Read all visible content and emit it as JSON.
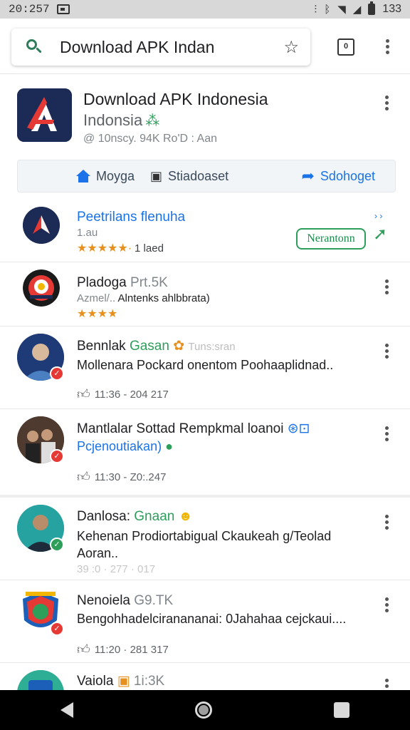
{
  "status_bar": {
    "time": "20:257",
    "battery": "133",
    "icons": [
      "image-icon",
      "vibrate-icon",
      "bluetooth-icon",
      "wifi-icon",
      "signal-icon",
      "battery-icon"
    ]
  },
  "search": {
    "value": "Download APK Indan",
    "tabs_count": "0"
  },
  "header": {
    "title": "Download APK Indonesia",
    "subtitle": "Indonsia",
    "meta": "@ 10nscy. 94K Ro'D : Aan",
    "actions": {
      "home": "Moyga",
      "chat": "Stiadoaset",
      "share": "Sdohoget"
    }
  },
  "items": [
    {
      "title": "Peetrilans flenuha",
      "line1": "1.au",
      "rating_text": "1 laed",
      "open_label": "Nerantonn",
      "arrows": "› ›"
    },
    {
      "title": "Pladoga",
      "title_extra": "Prt.5K",
      "line1_a": "Azmel/..",
      "line1_b": "Alntenks ahlbbrata)"
    },
    {
      "title": "Bennlak",
      "title_green": "Gasan",
      "title_faded": "Tuns:sran",
      "line1": "Mollenara Pockard onentom Poohaaplidnad..",
      "meta": "11:36 - 204 217"
    },
    {
      "title": "Mantlalar Sottad Rempkmal loanoi",
      "line1": "Pcjenoutiakan)",
      "meta": "11:30 - Z0:.247"
    },
    {
      "title": "Danlosa:",
      "title_green": "Gnaan",
      "line1": "Kehenan Prodiortabigual Ckaukeah g/Teolad",
      "line2": "Aoran..",
      "meta": "39 :0 · 277 · 017"
    },
    {
      "title": "Nenoiela",
      "title_extra": "G9.TK",
      "line1": "Bengohhadelciranananai: 0Jahahaa cejckaui....",
      "meta": "11:20 · 281 317"
    },
    {
      "title": "Vaiola",
      "title_extra": "1i:3K"
    }
  ],
  "colors": {
    "accent_green": "#2e9e5b",
    "accent_blue": "#1a73e8",
    "star_orange": "#e8901e",
    "verify_red": "#e53935"
  }
}
